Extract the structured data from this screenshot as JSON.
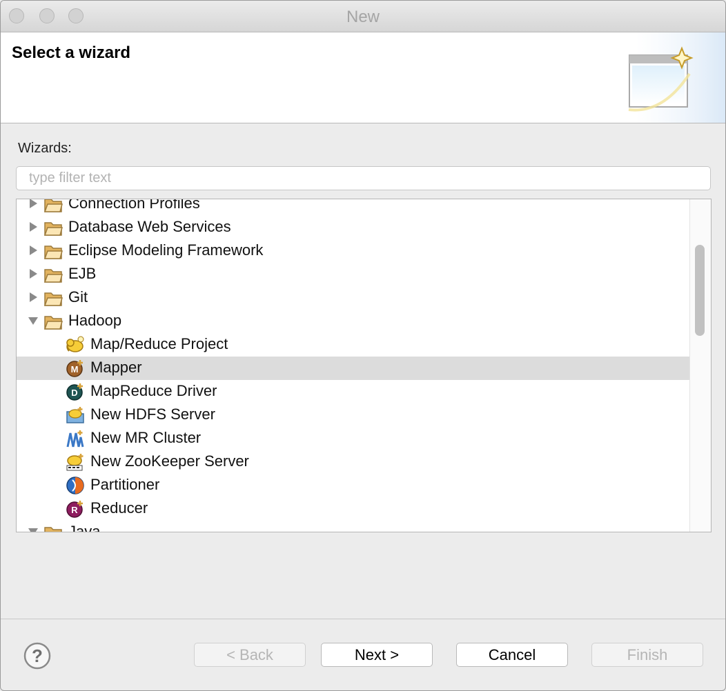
{
  "window": {
    "title": "New"
  },
  "banner": {
    "title": "Select a wizard",
    "icon": "wizard-window-sparkle-icon"
  },
  "wizards": {
    "label": "Wizards:",
    "filter_placeholder": "type filter text",
    "items": [
      {
        "label": "Connection Profiles",
        "type": "folder",
        "expanded": false,
        "level": 0
      },
      {
        "label": "Database Web Services",
        "type": "folder",
        "expanded": false,
        "level": 0
      },
      {
        "label": "Eclipse Modeling Framework",
        "type": "folder",
        "expanded": false,
        "level": 0
      },
      {
        "label": "EJB",
        "type": "folder",
        "expanded": false,
        "level": 0
      },
      {
        "label": "Git",
        "type": "folder",
        "expanded": false,
        "level": 0
      },
      {
        "label": "Hadoop",
        "type": "folder",
        "expanded": true,
        "level": 0
      },
      {
        "label": "Map/Reduce Project",
        "type": "item",
        "icon": "elephant-project-icon",
        "level": 1
      },
      {
        "label": "Mapper",
        "type": "item",
        "icon": "mapper-icon",
        "level": 1,
        "selected": true
      },
      {
        "label": "MapReduce Driver",
        "type": "item",
        "icon": "driver-icon",
        "level": 1
      },
      {
        "label": "New HDFS Server",
        "type": "item",
        "icon": "hdfs-server-icon",
        "level": 1
      },
      {
        "label": "New MR Cluster",
        "type": "item",
        "icon": "mr-cluster-icon",
        "level": 1
      },
      {
        "label": "New ZooKeeper Server",
        "type": "item",
        "icon": "zookeeper-icon",
        "level": 1
      },
      {
        "label": "Partitioner",
        "type": "item",
        "icon": "partitioner-icon",
        "level": 1
      },
      {
        "label": "Reducer",
        "type": "item",
        "icon": "reducer-icon",
        "level": 1
      },
      {
        "label": "Java",
        "type": "folder",
        "expanded": true,
        "level": 0
      }
    ]
  },
  "buttons": {
    "back": "< Back",
    "next": "Next >",
    "cancel": "Cancel",
    "finish": "Finish"
  },
  "help_icon": "question-mark-icon"
}
